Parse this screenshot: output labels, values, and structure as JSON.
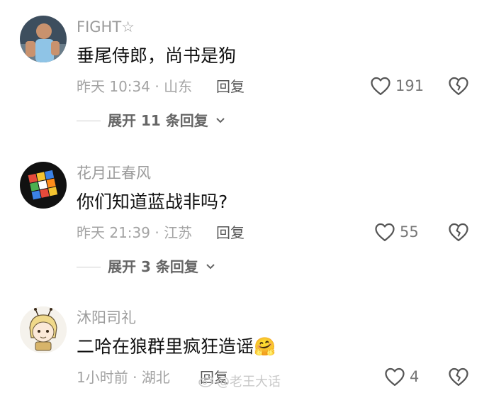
{
  "comments": [
    {
      "username": "FIGHT☆",
      "text": "垂尾侍郎，尚书是狗",
      "meta": "昨天 10:34 · 山东",
      "reply_label": "回复",
      "likes": "191",
      "expand_label": "展开 11 条回复"
    },
    {
      "username": "花月正春风",
      "text": "你们知道蓝战非吗?",
      "meta": "昨天 21:39 · 江苏",
      "reply_label": "回复",
      "likes": "55",
      "expand_label": "展开 3 条回复"
    },
    {
      "username": "沐阳司礼",
      "text": "二哈在狼群里疯狂造谣",
      "emoji": "🤗",
      "meta": "1小时前 · 湖北",
      "reply_label": "回复",
      "likes": "4"
    }
  ],
  "watermark": "@老王大话",
  "icons": {
    "like": "heart-outline-icon",
    "dislike": "broken-heart-icon",
    "expand": "chevron-down-icon"
  },
  "colors": {
    "text": "#111111",
    "secondary": "#9b9b9b",
    "icon": "#555555"
  }
}
